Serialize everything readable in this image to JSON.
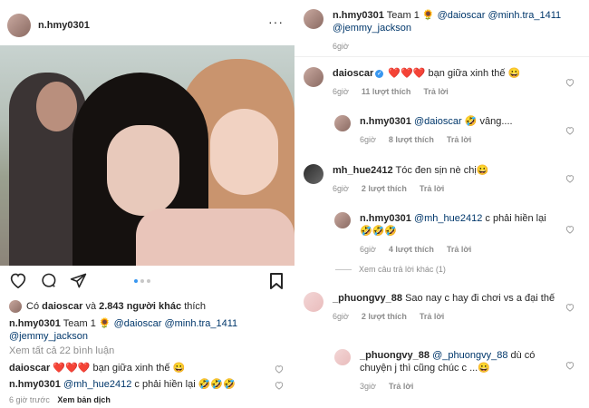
{
  "post": {
    "username": "n.hmy0301",
    "more_icon": "···",
    "likes_prefix": "Có",
    "likes_user": "daioscar",
    "likes_mid": "và",
    "likes_count": "2.843 người khác",
    "likes_suffix": "thích",
    "caption_user": "n.hmy0301",
    "caption_text": "Team 1 🌻",
    "caption_mentions": [
      "@daioscar",
      "@minh.tra_1411",
      "@jemmy_jackson"
    ],
    "view_all": "Xem tất cả 22 bình luận",
    "comments": [
      {
        "user": "daioscar",
        "text": "❤️❤️❤️ bạn giữa xinh thế 😀"
      },
      {
        "user": "n.hmy0301",
        "mention": "@mh_hue2412",
        "text": "c phải hiền lại 🤣🤣🤣"
      }
    ],
    "time": "6 giờ trước",
    "translate": "Xem bản dịch",
    "carousel_count": 3,
    "carousel_active": 1
  },
  "thread": {
    "op": {
      "user": "n.hmy0301",
      "text": "Team 1 🌻",
      "mentions": [
        "@daioscar",
        "@minh.tra_1411",
        "@jemmy_jackson"
      ],
      "time": "6giờ"
    },
    "comments": [
      {
        "user": "daioscar",
        "text": "❤️❤️❤️ bạn giữa xinh thế 😀",
        "time": "6giờ",
        "likes": "11 lượt thích",
        "reply": "Trả lời"
      },
      {
        "user": "n.hmy0301",
        "mention": "@daioscar",
        "text": "🤣 vâng....",
        "time": "6giờ",
        "likes": "8 lượt thích",
        "reply": "Trả lời"
      },
      {
        "user": "mh_hue2412",
        "text": "Tóc đen sịn nè chị😀",
        "time": "6giờ",
        "likes": "2 lượt thích",
        "reply": "Trả lời"
      },
      {
        "user": "n.hmy0301",
        "mention": "@mh_hue2412",
        "text": "c phải hiền lại 🤣🤣🤣",
        "time": "6giờ",
        "likes": "4 lượt thích",
        "reply": "Trả lời"
      },
      {
        "user": "_phuongvy_88",
        "text": "Sao nay c hay đi chơi vs a đại thế",
        "time": "6giờ",
        "likes": "2 lượt thích",
        "reply": "Trả lời"
      },
      {
        "user": "_phuongvy_88",
        "mention": "@_phuongvy_88",
        "text": "dù có chuyện j thì cũng chúc c ...😀",
        "time": "3giờ",
        "likes": "",
        "reply": "Trả lời"
      }
    ],
    "view_replies": "Xem câu trả lời khác (1)"
  },
  "colors": {
    "mention": "#00376b",
    "muted": "#8e8e8e",
    "active_dot": "#3897f0",
    "verified": "#3897f0"
  }
}
